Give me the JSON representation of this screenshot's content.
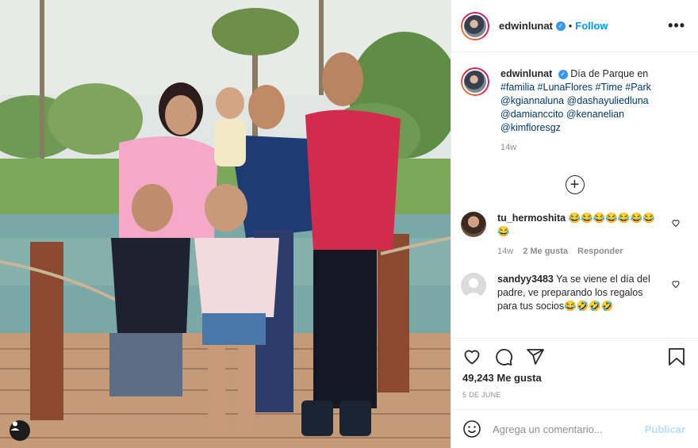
{
  "post": {
    "username": "edwinlunat",
    "follow_label": "Follow",
    "more_label": "•••",
    "caption": {
      "username": "edwinlunat",
      "text_start": "Día de Parque en",
      "hashtags": "#familia #LunaFlores #Time #Park",
      "mentions_1": "@kgiannaluna @dashayuliedluna",
      "mentions_2": "@damianccito @kenanelian",
      "mentions_3": "@kimfloresgz",
      "age": "14w"
    },
    "comments": [
      {
        "username": "tu_hermoshita",
        "text": "😂😂😂😂😂😂😂😂",
        "age": "14w",
        "likes": "2 Me gusta",
        "reply": "Responder"
      },
      {
        "username": "sandyy3483",
        "text": "Ya se viene el día del padre, ve preparando los regalos para tus socios😂🤣🤣🤣",
        "age": "",
        "likes": "",
        "reply": ""
      }
    ],
    "likes_count": "49,243 Me gusta",
    "date": "5 DE JUNE",
    "comment_placeholder": "Agrega un comentario...",
    "publish_label": "Publicar"
  },
  "colors": {
    "link_blue": "#0095f6",
    "verified_blue": "#3897f0",
    "hashtag": "#00376b",
    "muted": "#8e8e8e",
    "publish_disabled": "#b2dffc"
  },
  "icons": [
    "verified-badge-icon",
    "heart-icon",
    "comment-icon",
    "share-icon",
    "bookmark-icon",
    "emoji-icon",
    "plus-circle-icon",
    "person-tag-icon"
  ]
}
